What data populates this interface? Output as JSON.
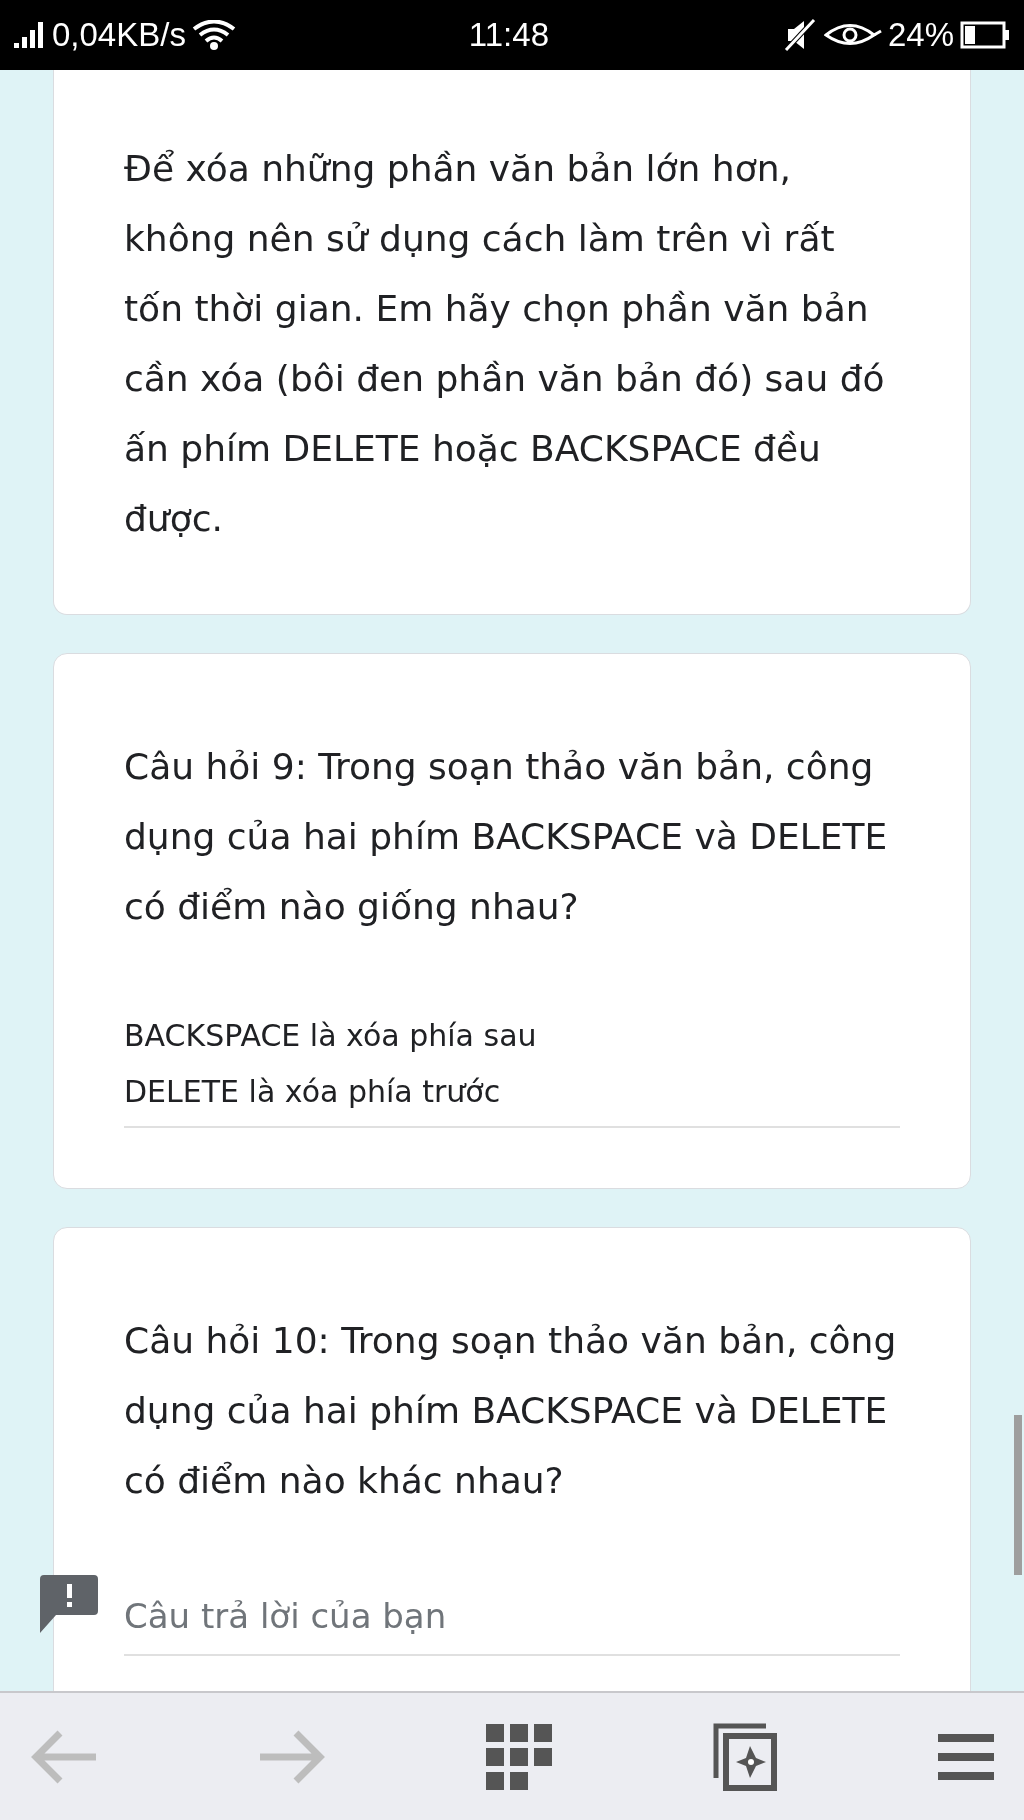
{
  "status_bar": {
    "speed": "0,04KB/s",
    "time": "11:48",
    "battery": "24%"
  },
  "cards": [
    {
      "kind": "text",
      "text": "Để xóa những phần văn bản lớn hơn, không nên sử dụng cách làm trên vì rất tốn thời gian. Em hãy chọn phần văn bản cần xóa (bôi đen phần văn bản đó) sau đó ấn phím DELETE hoặc BACKSPACE đều được."
    },
    {
      "kind": "question",
      "question": "Câu hỏi 9: Trong soạn thảo văn bản, công dụng của hai phím BACKSPACE và DELETE có điểm nào giống nhau?",
      "answer": "BACKSPACE là xóa phía sau\nDELETE là xóa phía trước"
    },
    {
      "kind": "question",
      "question": "Câu hỏi 10: Trong soạn thảo văn bản, công dụng của hai phím BACKSPACE và DELETE có điểm nào khác nhau?",
      "placeholder": "Câu trả lời của bạn"
    }
  ]
}
